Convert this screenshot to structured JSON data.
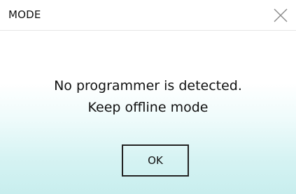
{
  "dialog": {
    "title": "MODE",
    "message_line1": "No programmer is detected.",
    "message_line2": "Keep offline mode",
    "ok_label": "OK"
  },
  "icons": {
    "close": "close-icon"
  },
  "colors": {
    "background_top": "#ffffff",
    "background_bottom": "#c8eeee",
    "text": "#111111",
    "button_border": "#222222"
  }
}
